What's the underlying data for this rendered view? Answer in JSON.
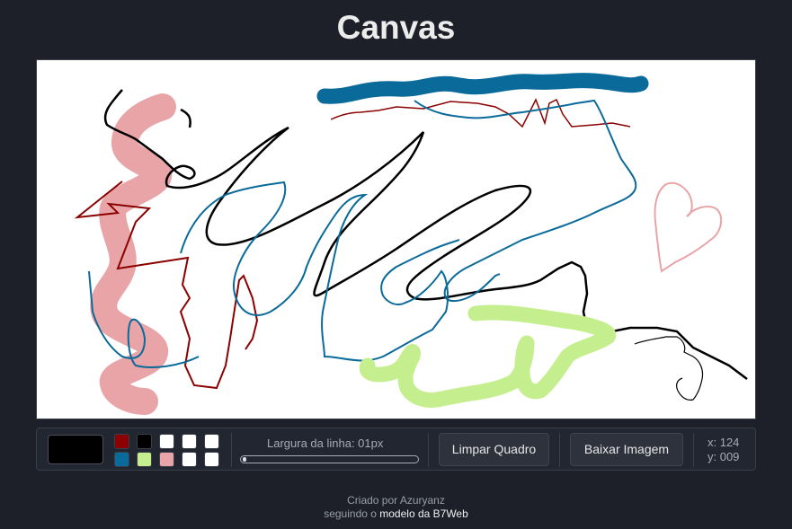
{
  "header": {
    "title": "Canvas"
  },
  "toolbar": {
    "current_color": "#000000",
    "swatches": [
      "#8b0000",
      "#000000",
      "#ffffff",
      "#ffffff",
      "#ffffff",
      "#0a6a9a",
      "#c5ef8e",
      "#e8a4a6",
      "#ffffff",
      "#ffffff"
    ],
    "line_width_label": "Largura da linha: 01px",
    "line_width_value": 1,
    "clear_button": "Limpar Quadro",
    "download_button": "Baixar Imagem",
    "coord_x": "x: 124",
    "coord_y": "y: 009"
  },
  "footer": {
    "line1": "Criado por Azuryanz",
    "line2_prefix": "seguindo o",
    "line2_link": "modelo da B7Web"
  },
  "colors": {
    "background": "#1d2029",
    "canvas": "#ffffff",
    "dark_red": "#8b0000",
    "blue": "#0a6a9a",
    "lime": "#c5ef8e",
    "pink": "#e8a4a6",
    "black": "#000000"
  }
}
